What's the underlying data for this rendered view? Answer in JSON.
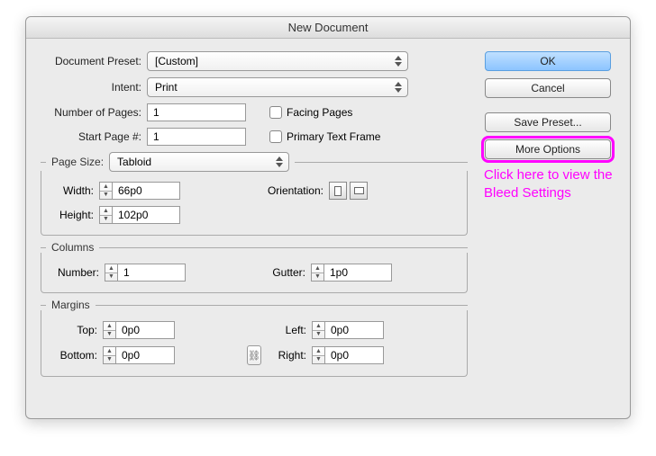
{
  "dialog": {
    "title": "New Document",
    "preset_label": "Document Preset:",
    "preset_value": "[Custom]",
    "intent_label": "Intent:",
    "intent_value": "Print",
    "pages_label": "Number of Pages:",
    "pages_value": "1",
    "facing_label": "Facing Pages",
    "start_label": "Start Page #:",
    "start_value": "1",
    "primary_label": "Primary Text Frame",
    "pagesize": {
      "title": "Page Size:",
      "value": "Tabloid",
      "width_label": "Width:",
      "width_value": "66p0",
      "height_label": "Height:",
      "height_value": "102p0",
      "orientation_label": "Orientation:"
    },
    "columns": {
      "title": "Columns",
      "number_label": "Number:",
      "number_value": "1",
      "gutter_label": "Gutter:",
      "gutter_value": "1p0"
    },
    "margins": {
      "title": "Margins",
      "top_label": "Top:",
      "top_value": "0p0",
      "bottom_label": "Bottom:",
      "bottom_value": "0p0",
      "left_label": "Left:",
      "left_value": "0p0",
      "right_label": "Right:",
      "right_value": "0p0"
    }
  },
  "buttons": {
    "ok": "OK",
    "cancel": "Cancel",
    "save_preset": "Save Preset...",
    "more_options": "More Options"
  },
  "annotation": "Click here to view the Bleed Settings"
}
